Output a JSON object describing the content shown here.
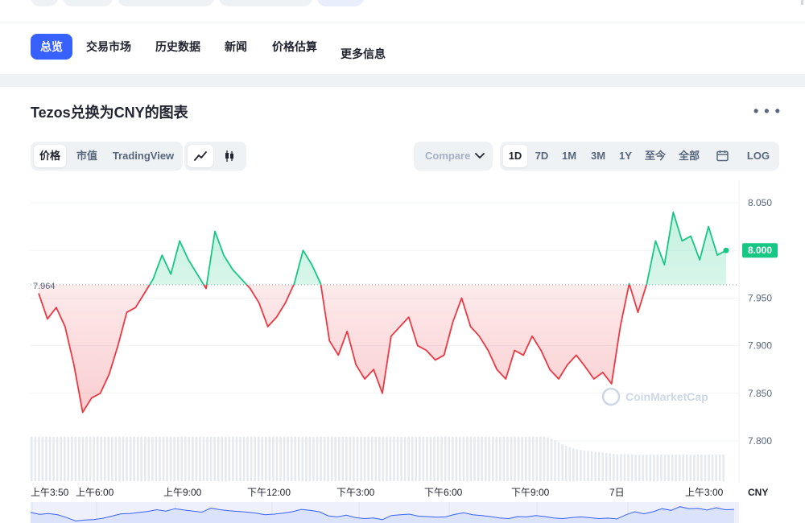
{
  "nav_tabs": [
    "总览",
    "交易市场",
    "历史数据",
    "新闻",
    "价格估算",
    "更多信息"
  ],
  "chart_title": "Tezos兑换为CNY的图表",
  "more_icon": "more-dots-icon",
  "type_toggle": [
    "价格",
    "市值",
    "TradingView"
  ],
  "chart_type_icons": [
    "line-chart-icon",
    "candlestick-icon"
  ],
  "compare_label": "Compare w",
  "range_buttons": [
    "1D",
    "7D",
    "1M",
    "3M",
    "1Y",
    "至今",
    "全部"
  ],
  "calendar_icon": "calendar-icon",
  "log_label": "LOG",
  "watermark": "CoinMarketCap",
  "colors": {
    "accent": "#3861fb",
    "up": "#16c784",
    "down": "#ea3943"
  },
  "chart_data": {
    "type": "line",
    "ylim": [
      7.77,
      8.07
    ],
    "y_ticks": [
      "8.050",
      "8.000",
      "7.950",
      "7.900",
      "7.850",
      "7.800"
    ],
    "x_ticks": [
      "上午3:50",
      "上午6:00",
      "上午9:00",
      "下午12:00",
      "下午3:00",
      "下午6:00",
      "下午9:00",
      "7日",
      "上午3:00"
    ],
    "currency_label": "CNY",
    "baseline": 7.964,
    "baseline_label": "7.964",
    "current_price": 8.0,
    "current_label": "8.000",
    "series": [
      {
        "values": [
          7.955,
          7.928,
          7.94,
          7.92,
          7.88,
          7.83,
          7.845,
          7.85,
          7.87,
          7.9,
          7.935,
          7.94,
          7.955,
          7.97,
          7.995,
          7.975,
          8.01,
          7.99,
          7.975,
          7.96,
          8.02,
          7.995,
          7.98,
          7.97,
          7.96,
          7.945,
          7.92,
          7.93,
          7.945,
          7.965,
          8.0,
          7.985,
          7.965,
          7.905,
          7.89,
          7.915,
          7.88,
          7.865,
          7.875,
          7.85,
          7.91,
          7.92,
          7.93,
          7.9,
          7.895,
          7.885,
          7.89,
          7.925,
          7.95,
          7.92,
          7.91,
          7.895,
          7.875,
          7.865,
          7.895,
          7.89,
          7.91,
          7.895,
          7.875,
          7.865,
          7.88,
          7.89,
          7.878,
          7.865,
          7.872,
          7.86,
          7.92,
          7.965,
          7.935,
          7.965,
          8.01,
          7.985,
          8.04,
          8.01,
          8.015,
          7.99,
          8.025,
          7.995,
          8.0
        ],
        "volumes": [
          0.92,
          0.92,
          0.92,
          0.92,
          0.92,
          0.92,
          0.92,
          0.92,
          0.92,
          0.92,
          0.92,
          0.92,
          0.92,
          0.92,
          0.92,
          0.92,
          0.92,
          0.92,
          0.92,
          0.92,
          0.92,
          0.92,
          0.92,
          0.92,
          0.92,
          0.92,
          0.92,
          0.92,
          0.92,
          0.92,
          0.92,
          0.92,
          0.92,
          0.92,
          0.92,
          0.92,
          0.92,
          0.92,
          0.92,
          0.92,
          0.92,
          0.92,
          0.92,
          0.92,
          0.92,
          0.92,
          0.92,
          0.92,
          0.92,
          0.92,
          0.92,
          0.92,
          0.92,
          0.92,
          0.92,
          0.92,
          0.92,
          0.92,
          0.92,
          0.85,
          0.75,
          0.68,
          0.64,
          0.62,
          0.6,
          0.58,
          0.56,
          0.56,
          0.55,
          0.55,
          0.55,
          0.55,
          0.55,
          0.55,
          0.55,
          0.55,
          0.55,
          0.55,
          0.55
        ]
      }
    ]
  }
}
